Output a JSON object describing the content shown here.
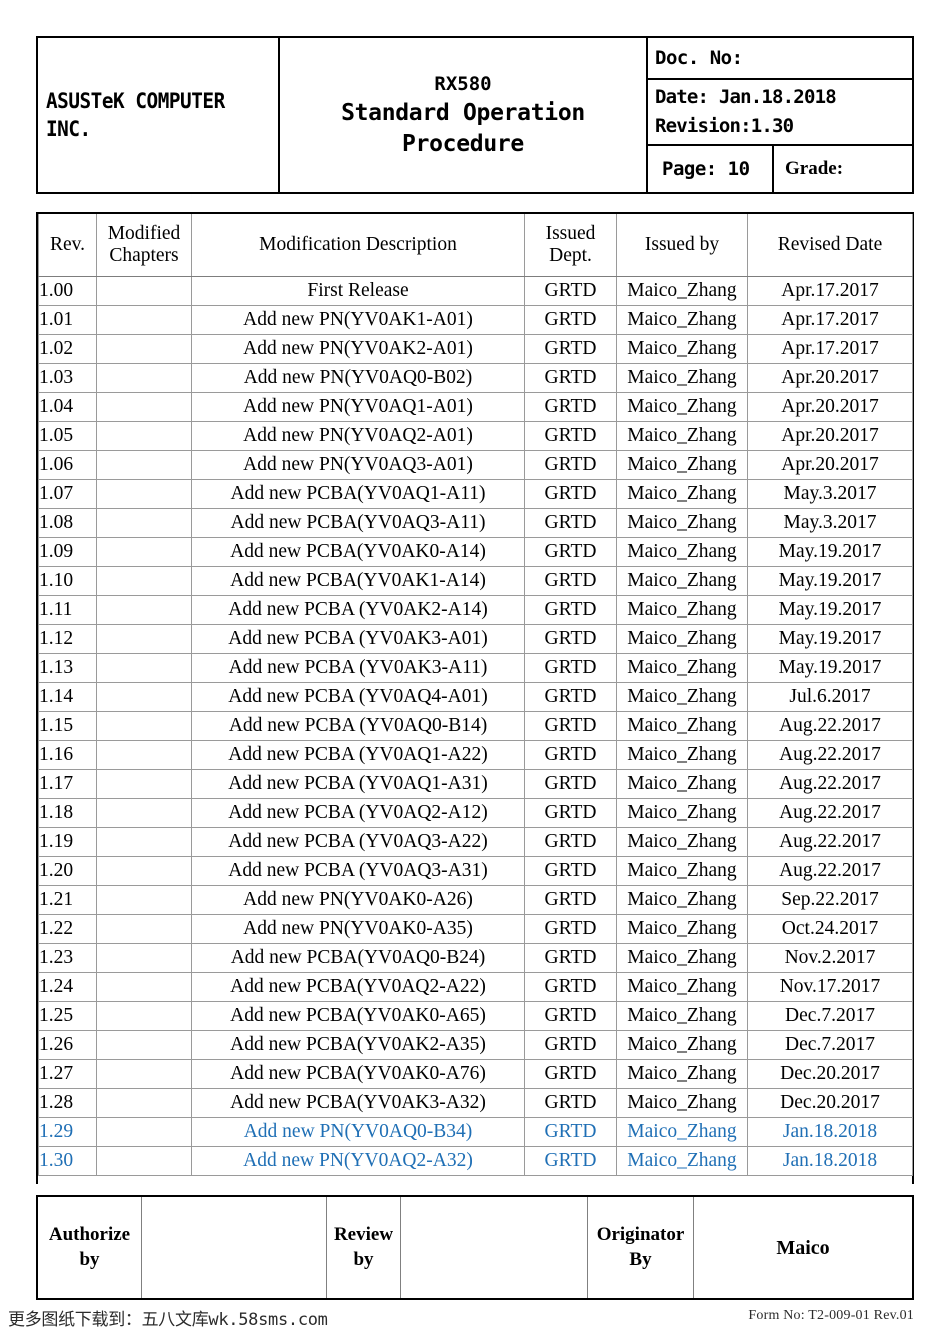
{
  "header": {
    "company": "ASUSTeK COMPUTER\nINC.",
    "model": "RX580",
    "doc_title": "Standard Operation Procedure",
    "doc_no_label": "Doc. No:",
    "date_line": "Date: Jan.18.2018",
    "revision_line": "Revision:1.30",
    "page_label": "Page: 10",
    "grade_label": "Grade:"
  },
  "table": {
    "columns": [
      "Rev.",
      "Modified\nChapters",
      "Modification Description",
      "Issued\nDept.",
      "Issued by",
      "Revised Date"
    ],
    "highlight_color": "#1f6fb5",
    "rows": [
      {
        "rev": "1.00",
        "chapters": "",
        "desc": "First Release",
        "dept": "GRTD",
        "by": "Maico_Zhang",
        "date": "Apr.17.2017",
        "highlight": false
      },
      {
        "rev": "1.01",
        "chapters": "",
        "desc": "Add new PN(YV0AK1-A01)",
        "dept": "GRTD",
        "by": "Maico_Zhang",
        "date": "Apr.17.2017",
        "highlight": false
      },
      {
        "rev": "1.02",
        "chapters": "",
        "desc": "Add new PN(YV0AK2-A01)",
        "dept": "GRTD",
        "by": "Maico_Zhang",
        "date": "Apr.17.2017",
        "highlight": false
      },
      {
        "rev": "1.03",
        "chapters": "",
        "desc": "Add new PN(YV0AQ0-B02)",
        "dept": "GRTD",
        "by": "Maico_Zhang",
        "date": "Apr.20.2017",
        "highlight": false
      },
      {
        "rev": "1.04",
        "chapters": "",
        "desc": "Add new PN(YV0AQ1-A01)",
        "dept": "GRTD",
        "by": "Maico_Zhang",
        "date": "Apr.20.2017",
        "highlight": false
      },
      {
        "rev": "1.05",
        "chapters": "",
        "desc": "Add new PN(YV0AQ2-A01)",
        "dept": "GRTD",
        "by": "Maico_Zhang",
        "date": "Apr.20.2017",
        "highlight": false
      },
      {
        "rev": "1.06",
        "chapters": "",
        "desc": "Add new PN(YV0AQ3-A01)",
        "dept": "GRTD",
        "by": "Maico_Zhang",
        "date": "Apr.20.2017",
        "highlight": false
      },
      {
        "rev": "1.07",
        "chapters": "",
        "desc": "Add new PCBA(YV0AQ1-A11)",
        "dept": "GRTD",
        "by": "Maico_Zhang",
        "date": "May.3.2017",
        "highlight": false
      },
      {
        "rev": "1.08",
        "chapters": "",
        "desc": "Add new PCBA(YV0AQ3-A11)",
        "dept": "GRTD",
        "by": "Maico_Zhang",
        "date": "May.3.2017",
        "highlight": false
      },
      {
        "rev": "1.09",
        "chapters": "",
        "desc": "Add new PCBA(YV0AK0-A14)",
        "dept": "GRTD",
        "by": "Maico_Zhang",
        "date": "May.19.2017",
        "highlight": false
      },
      {
        "rev": "1.10",
        "chapters": "",
        "desc": "Add new PCBA(YV0AK1-A14)",
        "dept": "GRTD",
        "by": "Maico_Zhang",
        "date": "May.19.2017",
        "highlight": false
      },
      {
        "rev": "1.11",
        "chapters": "",
        "desc": "Add new PCBA (YV0AK2-A14)",
        "dept": "GRTD",
        "by": "Maico_Zhang",
        "date": "May.19.2017",
        "highlight": false
      },
      {
        "rev": "1.12",
        "chapters": "",
        "desc": "Add new PCBA (YV0AK3-A01)",
        "dept": "GRTD",
        "by": "Maico_Zhang",
        "date": "May.19.2017",
        "highlight": false
      },
      {
        "rev": "1.13",
        "chapters": "",
        "desc": "Add new PCBA (YV0AK3-A11)",
        "dept": "GRTD",
        "by": "Maico_Zhang",
        "date": "May.19.2017",
        "highlight": false
      },
      {
        "rev": "1.14",
        "chapters": "",
        "desc": "Add new PCBA (YV0AQ4-A01)",
        "dept": "GRTD",
        "by": "Maico_Zhang",
        "date": "Jul.6.2017",
        "highlight": false
      },
      {
        "rev": "1.15",
        "chapters": "",
        "desc": "Add new PCBA (YV0AQ0-B14)",
        "dept": "GRTD",
        "by": "Maico_Zhang",
        "date": "Aug.22.2017",
        "highlight": false
      },
      {
        "rev": "1.16",
        "chapters": "",
        "desc": "Add new PCBA (YV0AQ1-A22)",
        "dept": "GRTD",
        "by": "Maico_Zhang",
        "date": "Aug.22.2017",
        "highlight": false
      },
      {
        "rev": "1.17",
        "chapters": "",
        "desc": "Add new PCBA (YV0AQ1-A31)",
        "dept": "GRTD",
        "by": "Maico_Zhang",
        "date": "Aug.22.2017",
        "highlight": false
      },
      {
        "rev": "1.18",
        "chapters": "",
        "desc": "Add new PCBA (YV0AQ2-A12)",
        "dept": "GRTD",
        "by": "Maico_Zhang",
        "date": "Aug.22.2017",
        "highlight": false
      },
      {
        "rev": "1.19",
        "chapters": "",
        "desc": "Add new PCBA (YV0AQ3-A22)",
        "dept": "GRTD",
        "by": "Maico_Zhang",
        "date": "Aug.22.2017",
        "highlight": false
      },
      {
        "rev": "1.20",
        "chapters": "",
        "desc": "Add new PCBA (YV0AQ3-A31)",
        "dept": "GRTD",
        "by": "Maico_Zhang",
        "date": "Aug.22.2017",
        "highlight": false
      },
      {
        "rev": "1.21",
        "chapters": "",
        "desc": "Add new PN(YV0AK0-A26)",
        "dept": "GRTD",
        "by": "Maico_Zhang",
        "date": "Sep.22.2017",
        "highlight": false
      },
      {
        "rev": "1.22",
        "chapters": "",
        "desc": "Add new PN(YV0AK0-A35)",
        "dept": "GRTD",
        "by": "Maico_Zhang",
        "date": "Oct.24.2017",
        "highlight": false
      },
      {
        "rev": "1.23",
        "chapters": "",
        "desc": "Add new PCBA(YV0AQ0-B24)",
        "dept": "GRTD",
        "by": "Maico_Zhang",
        "date": "Nov.2.2017",
        "highlight": false
      },
      {
        "rev": "1.24",
        "chapters": "",
        "desc": "Add new PCBA(YV0AQ2-A22)",
        "dept": "GRTD",
        "by": "Maico_Zhang",
        "date": "Nov.17.2017",
        "highlight": false
      },
      {
        "rev": "1.25",
        "chapters": "",
        "desc": "Add new PCBA(YV0AK0-A65)",
        "dept": "GRTD",
        "by": "Maico_Zhang",
        "date": "Dec.7.2017",
        "highlight": false
      },
      {
        "rev": "1.26",
        "chapters": "",
        "desc": "Add new PCBA(YV0AK2-A35)",
        "dept": "GRTD",
        "by": "Maico_Zhang",
        "date": "Dec.7.2017",
        "highlight": false
      },
      {
        "rev": "1.27",
        "chapters": "",
        "desc": "Add new PCBA(YV0AK0-A76)",
        "dept": "GRTD",
        "by": "Maico_Zhang",
        "date": "Dec.20.2017",
        "highlight": false
      },
      {
        "rev": "1.28",
        "chapters": "",
        "desc": "Add new PCBA(YV0AK3-A32)",
        "dept": "GRTD",
        "by": "Maico_Zhang",
        "date": "Dec.20.2017",
        "highlight": false
      },
      {
        "rev": "1.29",
        "chapters": "",
        "desc": "Add new PN(YV0AQ0-B34)",
        "dept": "GRTD",
        "by": "Maico_Zhang",
        "date": "Jan.18.2018",
        "highlight": true
      },
      {
        "rev": "1.30",
        "chapters": "",
        "desc": "Add new PN(YV0AQ2-A32)",
        "dept": "GRTD",
        "by": "Maico_Zhang",
        "date": "Jan.18.2018",
        "highlight": true
      }
    ]
  },
  "signature": {
    "authorize_label": "Authorize\nby",
    "authorize_value": "",
    "review_label": "Review\nby",
    "review_value": "",
    "originator_label": "Originator\nBy",
    "originator_value": "Maico"
  },
  "footer": {
    "watermark": "更多图纸下载到：五八文库wk.58sms.com",
    "form_no": "Form No: T2-009-01  Rev.01"
  }
}
